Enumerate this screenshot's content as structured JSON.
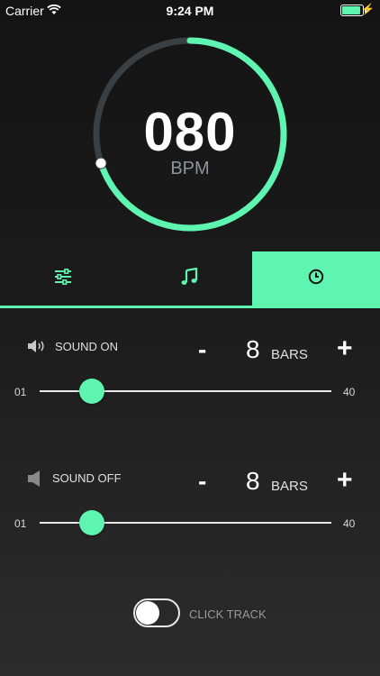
{
  "status_bar": {
    "carrier": "Carrier",
    "time": "9:24 PM"
  },
  "tempo": {
    "value": "080",
    "label": "BPM",
    "progress_fraction": 0.7
  },
  "colors": {
    "accent": "#5ef5b1",
    "track": "#3a3f44",
    "background": "#1a1a1a"
  },
  "tabs": [
    {
      "name": "mixer",
      "icon": "sliders-icon",
      "active": false
    },
    {
      "name": "music",
      "icon": "music-note-icon",
      "active": false
    },
    {
      "name": "timer",
      "icon": "clock-icon",
      "active": true
    }
  ],
  "sound_on": {
    "label": "SOUND ON",
    "icon": "speaker-on-icon",
    "minus": "-",
    "count": "8",
    "unit": "BARS",
    "plus": "+",
    "slider": {
      "min_label": "01",
      "max_label": "40",
      "value": 8,
      "min": 1,
      "max": 40
    }
  },
  "sound_off": {
    "label": "SOUND OFF",
    "icon": "speaker-off-icon",
    "minus": "-",
    "count": "8",
    "unit": "BARS",
    "plus": "+",
    "slider": {
      "min_label": "01",
      "max_label": "40",
      "value": 8,
      "min": 1,
      "max": 40
    }
  },
  "click_track": {
    "label": "CLICK TRACK",
    "enabled": false
  }
}
